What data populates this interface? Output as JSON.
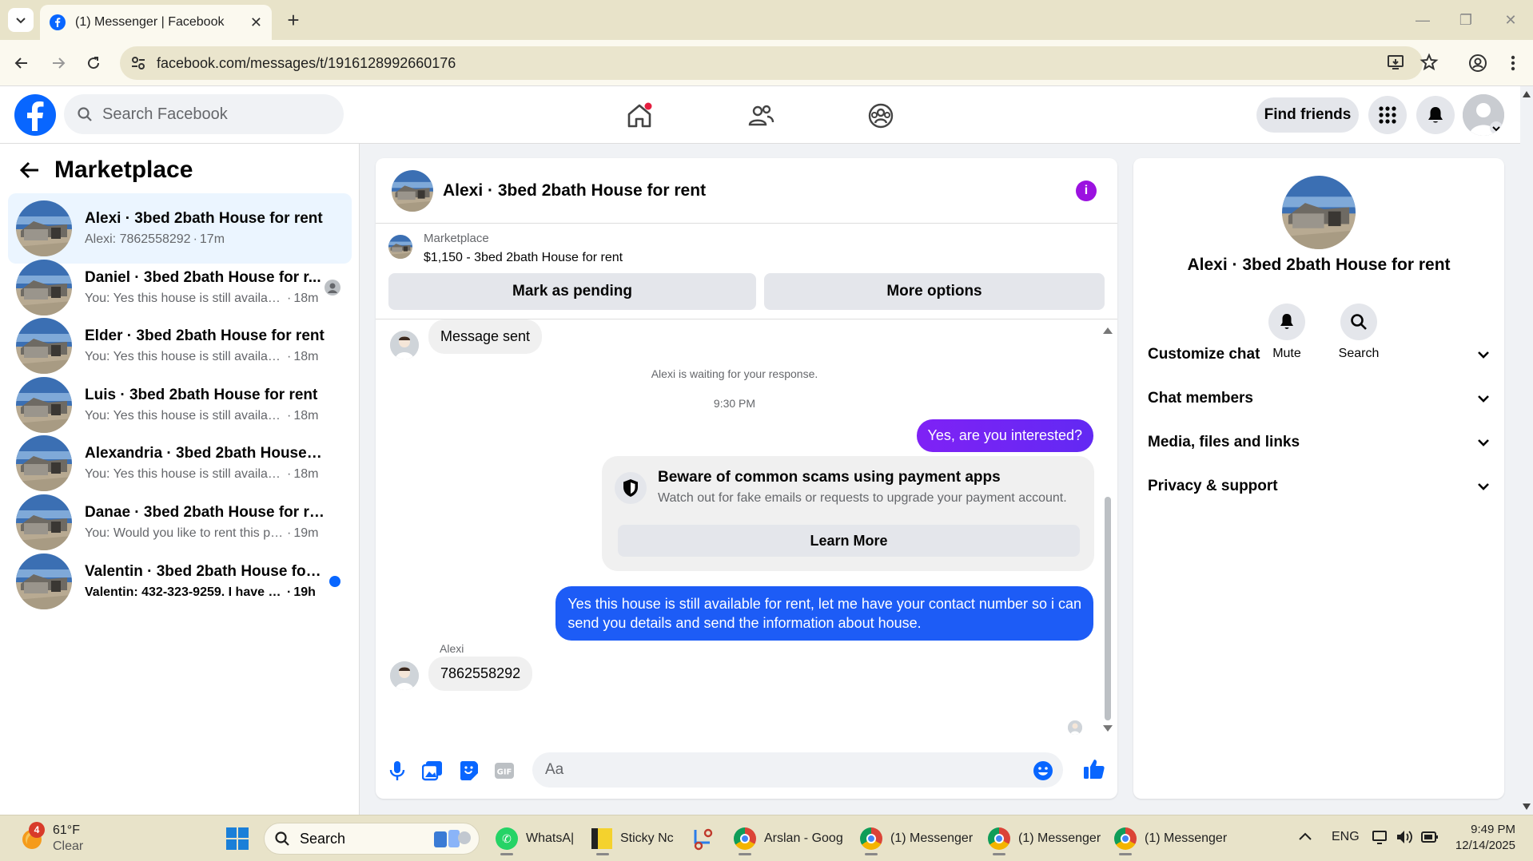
{
  "browser": {
    "tab_title": "(1) Messenger | Facebook",
    "url": "facebook.com/messages/t/1916128992660176"
  },
  "fb": {
    "search_placeholder": "Search Facebook",
    "find_friends": "Find friends"
  },
  "sidebar": {
    "title": "Marketplace",
    "conversations": [
      {
        "name": "Alexi · 3bed 2bath House for rent",
        "preview": "Alexi: 7862558292",
        "time": "17m",
        "active": true
      },
      {
        "name": "Daniel · 3bed 2bath House for r...",
        "preview": "You: Yes this house is still availabl...",
        "time": "18m"
      },
      {
        "name": "Elder · 3bed 2bath House for rent",
        "preview": "You: Yes this house is still available f...",
        "time": "18m"
      },
      {
        "name": "Luis · 3bed 2bath House for rent",
        "preview": "You: Yes this house is still available f...",
        "time": "18m"
      },
      {
        "name": "Alexandria · 3bed 2bath House for...",
        "preview": "You: Yes this house is still available f...",
        "time": "18m"
      },
      {
        "name": "Danae · 3bed 2bath House for rent",
        "preview": "You: Would you like to rent this pro...",
        "time": "19m"
      },
      {
        "name": "Valentin · 3bed 2bath House for ...",
        "preview": "Valentin: 432-323-9259. I have tw...",
        "time": "19h",
        "unread": true
      }
    ]
  },
  "chat": {
    "title": "Alexi · 3bed 2bath House for rent",
    "marketplace_label": "Marketplace",
    "listing": "$1,150 - 3bed 2bath House for rent",
    "mark_pending": "Mark as pending",
    "more_options": "More options",
    "messages": {
      "msg_sent": "Message sent",
      "waiting": "Alexi is waiting for your response.",
      "time": "9:30 PM",
      "out1": "Yes, are you interested?",
      "warning_title": "Beware of common scams using payment apps",
      "warning_text": "Watch out for fake emails or requests to upgrade your payment account.",
      "learn_more": "Learn More",
      "out2_line1": "Yes this house is still available for rent, let me have your contact number so i can",
      "out2_line2": "send you details and send the information about house.",
      "sender": "Alexi",
      "in_phone": "7862558292"
    },
    "composer_placeholder": "Aa"
  },
  "rpanel": {
    "name": "Alexi · 3bed 2bath House for rent",
    "mute": "Mute",
    "search": "Search",
    "rows": [
      "Customize chat",
      "Chat members",
      "Media, files and links",
      "Privacy & support"
    ]
  },
  "taskbar": {
    "weather_temp": "61°F",
    "weather_desc": "Clear",
    "weather_badge": "4",
    "search": "Search",
    "apps": [
      "WhatsA|",
      "Sticky Nc",
      "Arslan - Goog",
      "(1) Messenger",
      "(1) Messenger",
      "(1) Messenger"
    ],
    "lang": "ENG",
    "time": "9:49 PM",
    "date": "12/14/2025"
  },
  "colors": {
    "fb_blue": "#0866ff",
    "outgoing_purple": "#7f22f5",
    "outgoing_blue": "#1d5cf6",
    "info_purple": "#9b12e0",
    "unread_dot": "#0866ff"
  }
}
